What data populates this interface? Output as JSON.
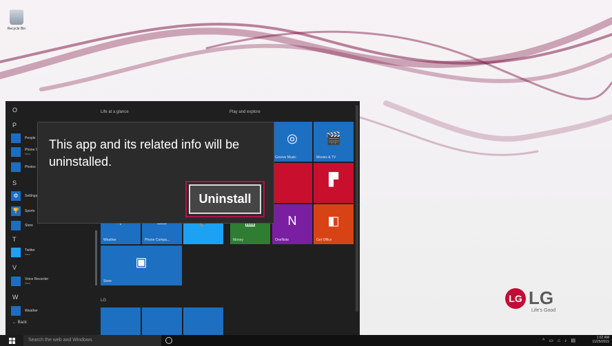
{
  "desktop": {
    "recycle_bin_label": "Recycle Bin",
    "brand": {
      "logo_letters": "LG",
      "name": "LG",
      "tagline": "Life's Good",
      "color": "#c40a36"
    }
  },
  "start_menu": {
    "letters": [
      "O",
      "P",
      "S",
      "T",
      "V",
      "W"
    ],
    "apps": [
      {
        "name": "People",
        "sub": ""
      },
      {
        "name": "Phone Companion",
        "sub": "New"
      },
      {
        "name": "Photos",
        "sub": ""
      },
      {
        "name": "Settings",
        "sub": ""
      },
      {
        "name": "Sports",
        "sub": ""
      },
      {
        "name": "Store",
        "sub": ""
      },
      {
        "name": "Twitter",
        "sub": "New"
      },
      {
        "name": "Voice Recorder",
        "sub": "New"
      },
      {
        "name": "Weather",
        "sub": ""
      }
    ],
    "back_label": "Back",
    "sections": {
      "life": "Life at a glance",
      "play": "Play and explore",
      "lg": "LG"
    },
    "tiles": {
      "groove": "Groove Music",
      "movies": "Movies & TV",
      "weather": "Weather",
      "phone": "Phone Compa...",
      "money": "Money",
      "onenote": "OneNote",
      "office": "Get Office",
      "store": "Store"
    }
  },
  "dialog": {
    "message": "This app and its related info will be uninstalled.",
    "uninstall_label": "Uninstall",
    "accent_color": "#b3124a"
  },
  "taskbar": {
    "search_placeholder": "Search the web and Windows",
    "time": "1:02 AM",
    "date": "11/25/2015"
  }
}
